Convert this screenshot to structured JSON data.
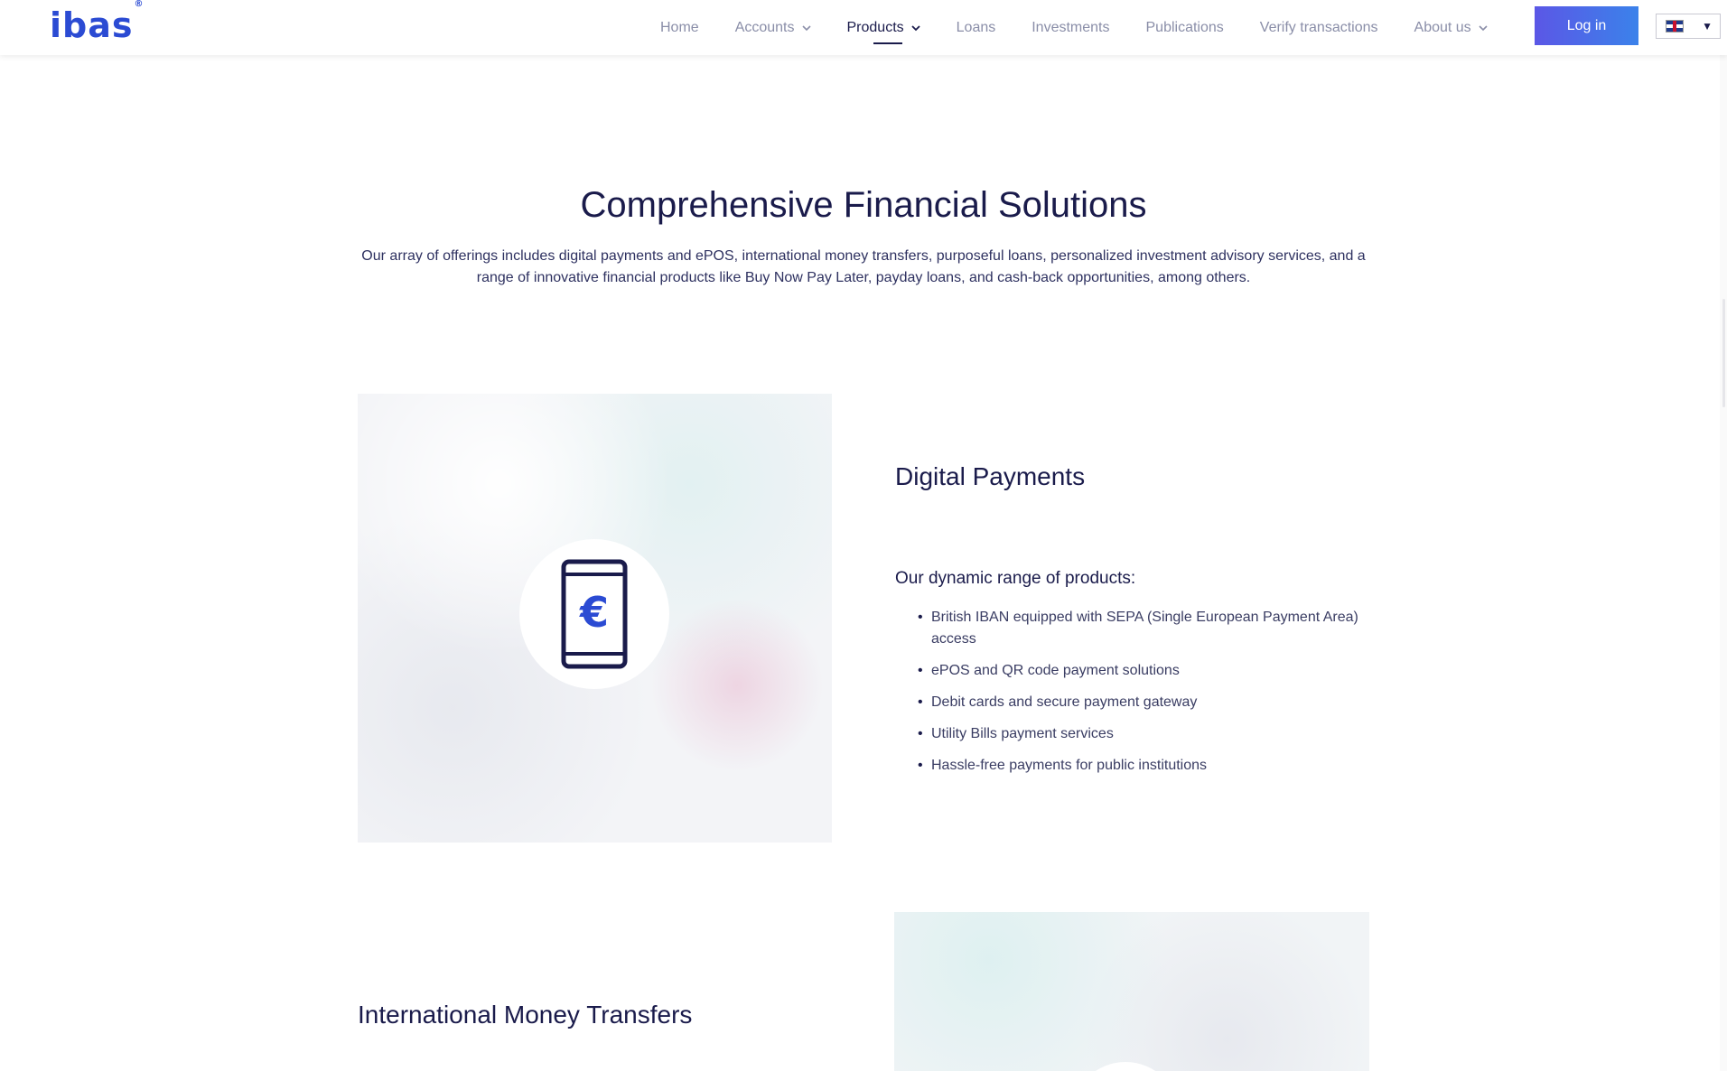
{
  "header": {
    "logo": "ibas",
    "logo_mark": "®",
    "nav": [
      {
        "label": "Home",
        "has_dropdown": false
      },
      {
        "label": "Accounts",
        "has_dropdown": true
      },
      {
        "label": "Products",
        "has_dropdown": true,
        "active": true
      },
      {
        "label": "Loans",
        "has_dropdown": false
      },
      {
        "label": "Investments",
        "has_dropdown": false
      },
      {
        "label": "Publications",
        "has_dropdown": false
      },
      {
        "label": "Verify transactions",
        "has_dropdown": false
      },
      {
        "label": "About us",
        "has_dropdown": true
      }
    ],
    "login_label": "Log in",
    "language_selector": {
      "flag": "uk-flag-icon",
      "caret": "▼"
    }
  },
  "intro": {
    "title": "Comprehensive Financial Solutions",
    "description": "Our array of offerings includes digital payments and ePOS, international money transfers, purposeful loans, personalized investment advisory services, and a range of innovative financial products like Buy Now Pay Later, payday loans, and cash-back opportunities, among others."
  },
  "digital_payments": {
    "title": "Digital Payments",
    "icon": "phone-euro-icon",
    "subtitle": "Our dynamic range of products:",
    "items": [
      "British IBAN equipped with SEPA (Single European Payment Area) access",
      "ePOS and QR code payment solutions",
      "Debit cards and secure payment gateway",
      "Utility Bills payment services",
      "Hassle-free payments for public institutions"
    ]
  },
  "international_transfers": {
    "title": "International Money Transfers"
  },
  "colors": {
    "brand": "#2b4bd3",
    "text_dark": "#1a1b4b",
    "nav_muted": "#8a8ea8",
    "login_gradient_start": "#5b57e6",
    "login_gradient_end": "#3b82ea"
  }
}
